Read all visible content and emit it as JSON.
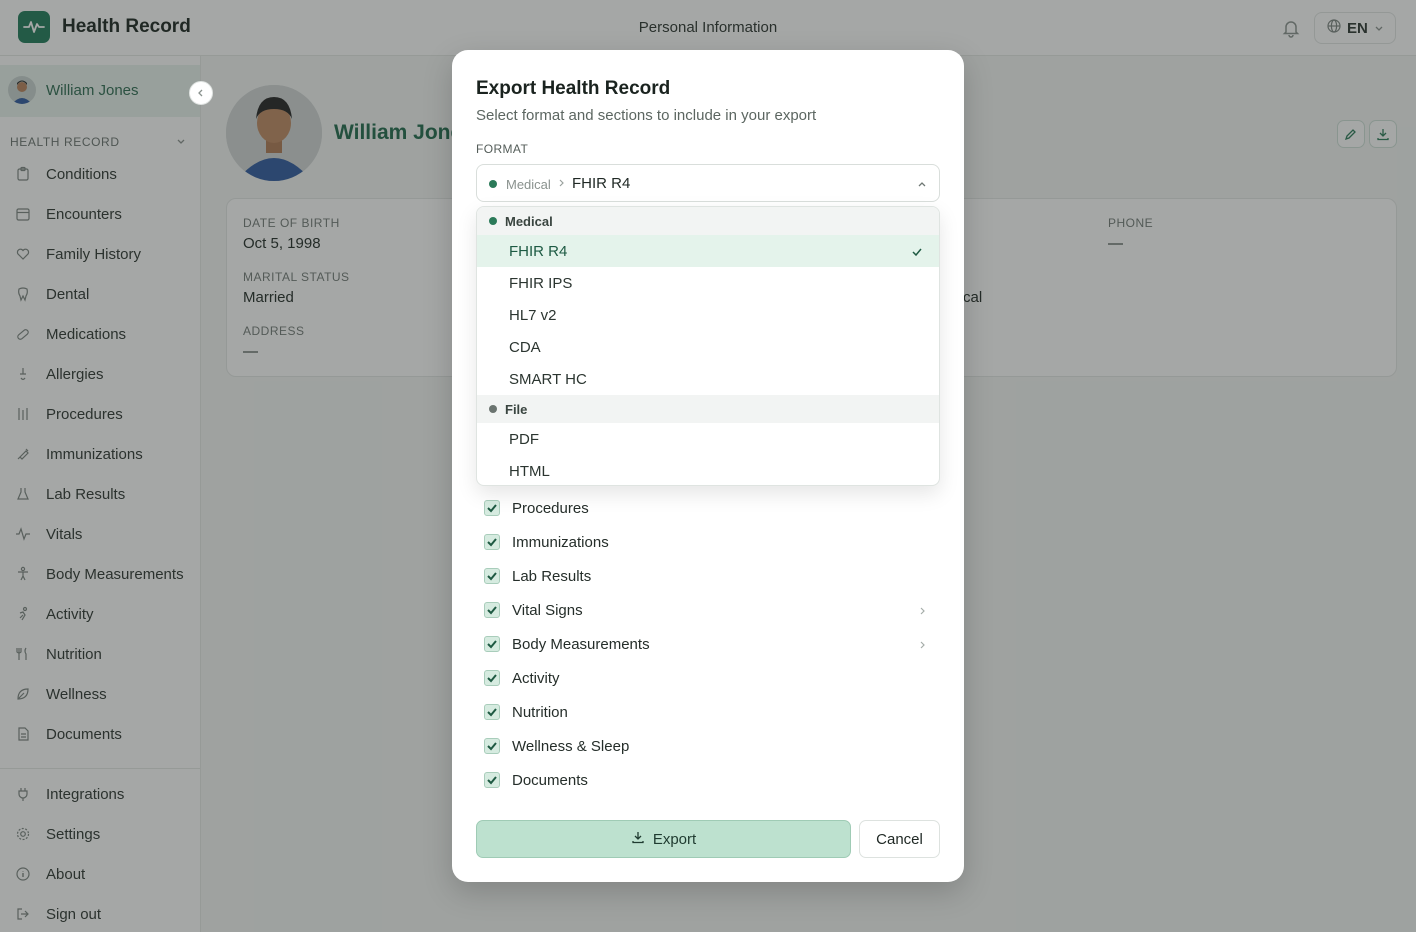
{
  "app": {
    "title": "Health Record",
    "page_title": "Personal Information",
    "language": "EN"
  },
  "sidebar": {
    "user_name": "William Jones",
    "section_header": "HEALTH RECORD",
    "items": [
      {
        "label": "Conditions",
        "icon": "clipboard-icon"
      },
      {
        "label": "Encounters",
        "icon": "calendar-icon"
      },
      {
        "label": "Family History",
        "icon": "heart-icon"
      },
      {
        "label": "Dental",
        "icon": "tooth-icon"
      },
      {
        "label": "Medications",
        "icon": "pill-icon"
      },
      {
        "label": "Allergies",
        "icon": "allergy-icon"
      },
      {
        "label": "Procedures",
        "icon": "procedure-icon"
      },
      {
        "label": "Immunizations",
        "icon": "syringe-icon"
      },
      {
        "label": "Lab Results",
        "icon": "flask-icon"
      },
      {
        "label": "Vitals",
        "icon": "pulse-icon"
      },
      {
        "label": "Body Measurements",
        "icon": "body-icon"
      },
      {
        "label": "Activity",
        "icon": "activity-icon"
      },
      {
        "label": "Nutrition",
        "icon": "utensils-icon"
      },
      {
        "label": "Wellness",
        "icon": "leaf-icon"
      },
      {
        "label": "Documents",
        "icon": "document-icon"
      }
    ],
    "bottom_items": [
      {
        "label": "Integrations",
        "icon": "plug-icon"
      },
      {
        "label": "Settings",
        "icon": "gear-icon"
      },
      {
        "label": "About",
        "icon": "info-icon"
      },
      {
        "label": "Sign out",
        "icon": "sign-out-icon"
      }
    ]
  },
  "profile": {
    "name": "William Jones",
    "fields": {
      "dob_label": "DATE OF BIRTH",
      "dob_value": "Oct 5, 1998",
      "marital_label": "MARITAL STATUS",
      "marital_value": "Married",
      "address_label": "ADDRESS",
      "address_value": "—",
      "phone_label": "PHONE",
      "phone_value": "—",
      "partial_value": "cal"
    }
  },
  "modal": {
    "title": "Export Health Record",
    "subtitle": "Select format and sections to include in your export",
    "format_label": "FORMAT",
    "selected_group": "Medical",
    "selected_value": "FHIR R4",
    "dropdown": {
      "groups": [
        {
          "label": "Medical",
          "dot_color": "#2b7a59",
          "options": [
            "FHIR R4",
            "FHIR IPS",
            "HL7 v2",
            "CDA",
            "SMART HC"
          ]
        },
        {
          "label": "File",
          "dot_color": "#6b7470",
          "options": [
            "PDF",
            "HTML"
          ]
        }
      ]
    },
    "sections": [
      "Procedures",
      "Immunizations",
      "Lab Results",
      "Vital Signs",
      "Body Measurements",
      "Activity",
      "Nutrition",
      "Wellness & Sleep",
      "Documents"
    ],
    "export_label": "Export",
    "cancel_label": "Cancel"
  },
  "colors": {
    "accent": "#1f7a5a",
    "selected_bg": "#e4f3eb",
    "export_bg": "#bde1cf"
  }
}
